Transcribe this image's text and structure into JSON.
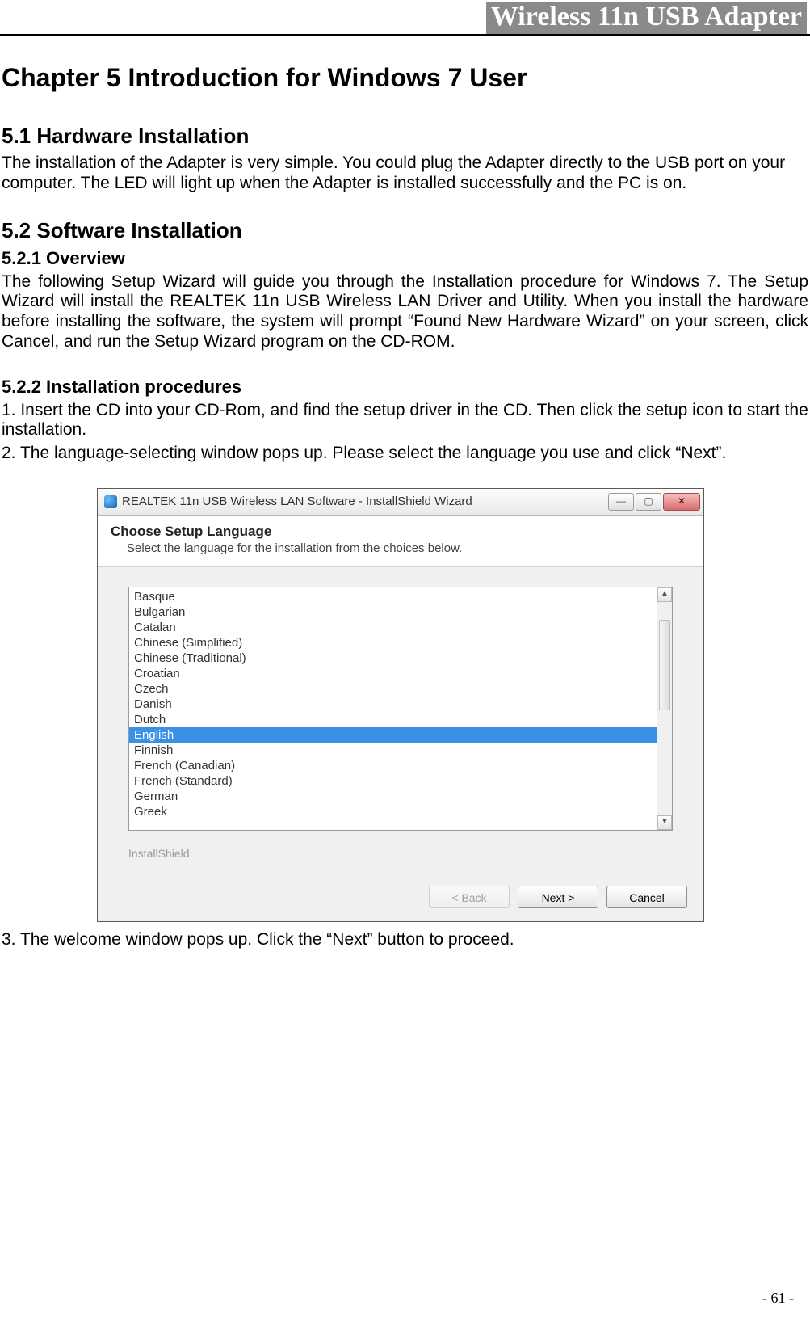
{
  "header": {
    "title": "Wireless 11n USB Adapter"
  },
  "chapter": {
    "title": "Chapter 5   Introduction for Windows 7 User"
  },
  "section_51": {
    "title": "5.1 Hardware Installation",
    "body": "The installation of the Adapter is very simple. You could plug the Adapter directly to the USB port on your computer. The LED will light up when the Adapter is installed successfully and the PC is on."
  },
  "section_52": {
    "title": "5.2 Software Installation"
  },
  "sub_521": {
    "title": "5.2.1 Overview",
    "body": "The following Setup Wizard will guide you through the Installation procedure for Windows 7. The Setup Wizard will install the REALTEK 11n USB Wireless LAN Driver and Utility. When you install the hardware before installing the software, the system will prompt “Found New Hardware Wizard” on your screen, click Cancel, and run the Setup Wizard program on the CD-ROM."
  },
  "sub_522": {
    "title": "5.2.2 Installation procedures",
    "step1": "1. Insert the CD into your CD-Rom, and find the setup driver in the CD. Then click the setup icon to start the installation.",
    "step2": "2. The language-selecting window pops up. Please select the language you use and click “Next”.",
    "step3": "3. The welcome window pops up. Click the “Next” button to proceed."
  },
  "dialog": {
    "window_title": "REALTEK 11n USB Wireless LAN Software - InstallShield Wizard",
    "header_main": "Choose Setup Language",
    "header_sub": "Select the language for the installation from the choices below.",
    "languages": [
      "Basque",
      "Bulgarian",
      "Catalan",
      "Chinese (Simplified)",
      "Chinese (Traditional)",
      "Croatian",
      "Czech",
      "Danish",
      "Dutch",
      "English",
      "Finnish",
      "French (Canadian)",
      "French (Standard)",
      "German",
      "Greek"
    ],
    "selected_index": 9,
    "brand": "InstallShield",
    "back_label": "< Back",
    "next_label": "Next >",
    "cancel_label": "Cancel"
  },
  "page_number": "- 61 -"
}
